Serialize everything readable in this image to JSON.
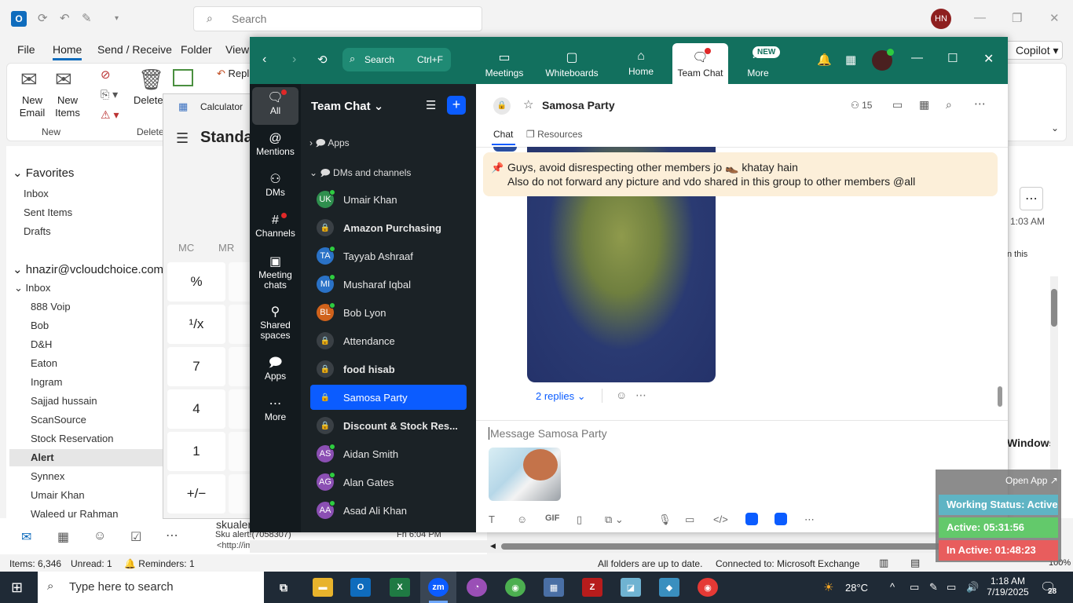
{
  "outlook": {
    "logo": "O",
    "search_placeholder": "Search",
    "avatar_initials": "HN",
    "menu": [
      "File",
      "Home",
      "Send / Receive",
      "Folder",
      "View"
    ],
    "copilot_label": "Copilot",
    "ribbon": {
      "new_email": "New Email",
      "new_items": "New Items",
      "new_group": "New",
      "delete_label": "Delete",
      "delete_group": "Delete",
      "reply_partial": "Repl"
    },
    "favorites": {
      "title": "Favorites",
      "items": [
        "Inbox",
        "Sent Items",
        "Drafts"
      ]
    },
    "account": {
      "title": "hnazir@vcloudchoice.com",
      "inbox": "Inbox",
      "folders": [
        "888 Voip",
        "Bob",
        "D&H",
        "Eaton",
        "Ingram",
        "Sajjad hussain",
        "ScanSource",
        "Stock Reservation",
        "Alert",
        "Synnex",
        "Umair Khan",
        "Waleed ur Rahman"
      ]
    },
    "right_panel": {
      "time": "1:03 AM",
      "text_this": "n this",
      "windows_text": "Windows"
    },
    "email_preview": {
      "sender": "skualert",
      "subject": "Sku alert!(7058307)",
      "date": "Fri 6:04 PM",
      "url": "<http://image.synnex.com/prod/ecx/resou"
    },
    "status": {
      "items": "Items: 6,346",
      "unread": "Unread: 1",
      "reminders": "Reminders: 1",
      "sync": "All folders are up to date.",
      "connected": "Connected to: Microsoft Exchange",
      "zoom": "100%"
    }
  },
  "calculator": {
    "title": "Calculator",
    "mode": "Standa",
    "memory": [
      "MC",
      "MR"
    ],
    "buttons": [
      "%",
      "¹/x",
      "7",
      "4",
      "1",
      "+/−"
    ]
  },
  "zoom": {
    "search_label": "Search",
    "search_shortcut": "Ctrl+F",
    "top_tabs": [
      {
        "label": "Meetings"
      },
      {
        "label": "Whiteboards"
      },
      {
        "label": "Home"
      },
      {
        "label": "Team Chat"
      },
      {
        "label": "More",
        "badge": "NEW"
      }
    ],
    "sidebar": [
      "All",
      "Mentions",
      "DMs",
      "Channels",
      "Meeting chats",
      "Shared spaces",
      "Apps",
      "More"
    ],
    "list_title": "Team Chat",
    "sections": {
      "apps": "Apps",
      "dms": "DMs and channels"
    },
    "contacts": [
      {
        "initials": "UK",
        "name": "Umair Khan",
        "color": "#2f8f4e",
        "bold": false
      },
      {
        "initials": "",
        "name": "Amazon Purchasing",
        "lock": true,
        "bold": true
      },
      {
        "initials": "TA",
        "name": "Tayyab Ashraaf",
        "color": "#2a72c7",
        "bold": false
      },
      {
        "initials": "MI",
        "name": "Musharaf Iqbal",
        "color": "#2a72c7",
        "bold": false
      },
      {
        "initials": "BL",
        "name": "Bob Lyon",
        "color": "#d0621b",
        "bold": false
      },
      {
        "initials": "",
        "name": "Attendance",
        "lock": true,
        "bold": false
      },
      {
        "initials": "",
        "name": "food hisab",
        "lock": true,
        "bold": true
      },
      {
        "initials": "",
        "name": "Samosa Party",
        "lock": true,
        "bold": false,
        "active": true
      },
      {
        "initials": "",
        "name": "Discount & Stock Res...",
        "lock": true,
        "bold": true
      },
      {
        "initials": "AS",
        "name": "Aidan Smith",
        "color": "#8b4fb3",
        "bold": false
      },
      {
        "initials": "AG",
        "name": "Alan Gates",
        "color": "#8b4fb3",
        "bold": false
      },
      {
        "initials": "AA",
        "name": "Asad Ali Khan",
        "color": "#8b4fb3",
        "bold": false
      }
    ],
    "chat": {
      "title": "Samosa Party",
      "members": "15",
      "tabs": [
        "Chat",
        "Resources"
      ],
      "pinned_line1": "Guys, avoid disrespecting other members jo 👞 khatay hain",
      "pinned_line2": "Also do not forward any picture and vdo shared in this group to other members @all",
      "replies": "2 replies",
      "input_placeholder": "Message Samosa Party"
    }
  },
  "work_status": {
    "open_app": "Open App ↗",
    "status": "Working Status: Active",
    "active": "Active: 05:31:56",
    "inactive": "In Active: 01:48:23",
    "colors": {
      "status": "#5fb4c4",
      "active": "#63c96b",
      "inactive": "#e85d5d"
    }
  },
  "taskbar": {
    "search_placeholder": "Type here to search",
    "temp": "28°C",
    "time": "1:18 AM",
    "date": "7/19/2025",
    "notif_count": "28"
  }
}
